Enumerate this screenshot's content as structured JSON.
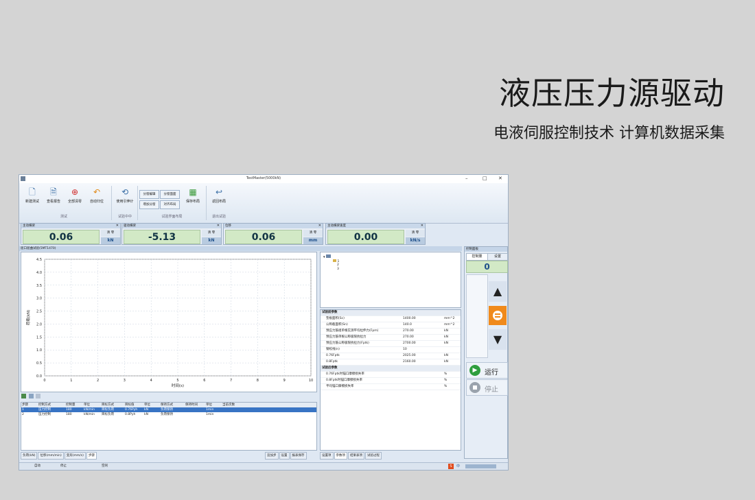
{
  "hero": {
    "title": "液压压力源驱动",
    "subtitle": "电液伺服控制技术 计算机数据采集"
  },
  "window": {
    "title": "TestMaster(5000kN)",
    "controls": [
      "–",
      "□",
      "✕"
    ]
  },
  "ribbon": {
    "buttons": [
      {
        "label": "新建测试",
        "icon": "new-file-icon",
        "glyph": "🗋"
      },
      {
        "label": "查看报告",
        "icon": "report-icon",
        "glyph": "🗎"
      },
      {
        "label": "全部清零",
        "icon": "lifebuoy-icon",
        "glyph": "⊕"
      },
      {
        "label": "自动归位",
        "icon": "undo-arrow-icon",
        "glyph": "↶"
      },
      {
        "label": "使用引伸计",
        "icon": "extensometer-icon",
        "glyph": "⟲"
      }
    ],
    "small_buttons": [
      "分窗编辑",
      "分窗面面",
      "增加分窗",
      "对齐布局"
    ],
    "layout_buttons": [
      {
        "label": "保存布局",
        "icon": "layout-save-icon",
        "glyph": "▦"
      },
      {
        "label": "返回布局",
        "icon": "layout-return-icon",
        "glyph": "↩"
      }
    ],
    "groups": [
      "测试",
      "试验中中",
      "试验界面布局",
      "退出试验"
    ]
  },
  "meters": [
    {
      "title": "主动横梁",
      "value": "0.06",
      "clear": "清 零",
      "unit": "kN"
    },
    {
      "title": "驱动横梁",
      "value": "-5.13",
      "clear": "清 零",
      "unit": "kN"
    },
    {
      "title": "位移",
      "value": "0.06",
      "clear": "清 零",
      "unit": "mm"
    },
    {
      "title": "主动横梁速度",
      "value": "0.00",
      "clear": "清 零",
      "unit": "kN/s"
    }
  ],
  "chart_panel_title": "屈口屈曲试验(5MT1470)",
  "chart_data": {
    "type": "line",
    "x": [],
    "series": [],
    "xlabel": "时间(s)",
    "ylabel": "荷载(kN)",
    "xlim": [
      0,
      10
    ],
    "ylim": [
      0,
      4.5
    ],
    "x_ticks": [
      "0",
      "1",
      "2",
      "3",
      "4",
      "5",
      "6",
      "7",
      "8",
      "9",
      "10"
    ],
    "y_ticks": [
      "0.0",
      "0.5",
      "1.0",
      "1.5",
      "2.0",
      "2.5",
      "3.0",
      "3.5",
      "4.0",
      "4.5"
    ],
    "grid": true
  },
  "step_table": {
    "headers": [
      "步骤",
      "控制方式",
      "控制量",
      "单位",
      "目标方式",
      "目标值",
      "单位",
      "保持方式",
      "保持时间",
      "单位",
      "当前次数"
    ],
    "rows": [
      [
        "1",
        "压力控制",
        "180",
        "kN/min",
        "目标负荷",
        "0.76Pyh",
        "kN",
        "负荷保持",
        "",
        "1min",
        ""
      ],
      [
        "2",
        "压力控制",
        "180",
        "kN/min",
        "目标负荷",
        "0.8Pyh",
        "kN",
        "负荷保持",
        "",
        "1min",
        ""
      ]
    ]
  },
  "bottom_tabs": [
    "负荷(kN)",
    "位移(mm/min)",
    "变形(mm/s)",
    "步骤"
  ],
  "bottom_buttons": [
    "追加步",
    "设置",
    "报表保存"
  ],
  "tree": {
    "root": "",
    "nodes": [
      "1",
      "2",
      "3"
    ]
  },
  "params": {
    "sections": [
      {
        "title": "试验前参数",
        "rows": [
          {
            "name": "垫板面积(Sc)",
            "value": "1400.00",
            "unit": "mm^2"
          },
          {
            "name": "公称截面积(Sn)",
            "value": "140.0",
            "unit": "mm^2"
          },
          {
            "name": "预应力筋组单根实测平均拉伸力(Fpm)",
            "value": "270.00",
            "unit": "kN"
          },
          {
            "name": "预应力筋单根公称极限抗拉力",
            "value": "270.00",
            "unit": "kN"
          },
          {
            "name": "预应力筋公称极限抗拉力(Fptk)",
            "value": "2700.00",
            "unit": "kN"
          },
          {
            "name": "钢绞线(n)",
            "value": "10",
            "unit": ""
          },
          {
            "name": "0.76Fptk",
            "value": "2025.00",
            "unit": "kN"
          },
          {
            "name": "0.8Fptk",
            "value": "2160.00",
            "unit": "kN"
          }
        ]
      },
      {
        "title": "试验后参数",
        "rows": [
          {
            "name": "0.76Fptk时锚口摩擦损失率",
            "value": "",
            "unit": "%"
          },
          {
            "name": "0.8Fptk时锚口摩擦损失率",
            "value": "",
            "unit": "%"
          },
          {
            "name": "平均锚口摩擦损失率",
            "value": "",
            "unit": "%"
          }
        ]
      }
    ],
    "tabs": [
      "设置项",
      "参数项",
      "结果表项",
      "试验过程"
    ]
  },
  "control_panel": {
    "title": "控制面板",
    "tabs": [
      "控制量",
      "设置"
    ],
    "value": "0",
    "run_label": "运行",
    "stop_label": "停止"
  },
  "status_bar": {
    "items": [
      "自动",
      "停止",
      "空闲"
    ]
  },
  "tray_icons": [
    "S",
    "中"
  ],
  "colors": {
    "meter_green": "#d2e9c6",
    "accent_orange": "#f08a1c",
    "run_green": "#2e9e3e"
  }
}
